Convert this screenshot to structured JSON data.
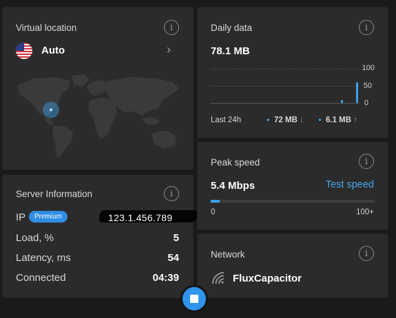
{
  "location": {
    "title": "Virtual location",
    "value": "Auto",
    "flag_icon": "us-flag-icon"
  },
  "daily": {
    "title": "Daily data",
    "total": "78.1 MB",
    "y_ticks": [
      "100",
      "50",
      "0"
    ],
    "range_label": "Last 24h",
    "download": "72 MB",
    "download_arrow": "↓",
    "upload": "6.1 MB",
    "upload_arrow": "↑",
    "accent": "#3ba1ee"
  },
  "chart_data": {
    "type": "bar",
    "ylim": [
      0,
      100
    ],
    "yticks": [
      0,
      50,
      100
    ],
    "series": [
      {
        "values": [
          0,
          0,
          0,
          0,
          0,
          0,
          0,
          0,
          0,
          0,
          0,
          0,
          0,
          0,
          0,
          0,
          0,
          0,
          0,
          0,
          0,
          0,
          0,
          0,
          0,
          0,
          0,
          0,
          0,
          0,
          0,
          0,
          0,
          0,
          0,
          0,
          0,
          0,
          0,
          0,
          0,
          0,
          0,
          0,
          0,
          0,
          0,
          0,
          0,
          0,
          0,
          0,
          8,
          0,
          0,
          0,
          0,
          0,
          60
        ]
      }
    ]
  },
  "peak": {
    "title": "Peak speed",
    "value": "5.4 Mbps",
    "test_label": "Test speed",
    "scale_min": "0",
    "scale_max": "100+",
    "fill_fraction": 0.054
  },
  "server": {
    "title": "Server Information",
    "ip_label": "IP",
    "premium_badge": "Premium",
    "ip_value": "123.1.456.789",
    "rows": [
      {
        "label": "Load, %",
        "value": "5"
      },
      {
        "label": "Latency, ms",
        "value": "54"
      },
      {
        "label": "Connected",
        "value": "04:39"
      }
    ]
  },
  "network": {
    "title": "Network",
    "name": "FluxCapacitor",
    "icon": "wifi-icon"
  },
  "info_icon_glyph": "i"
}
